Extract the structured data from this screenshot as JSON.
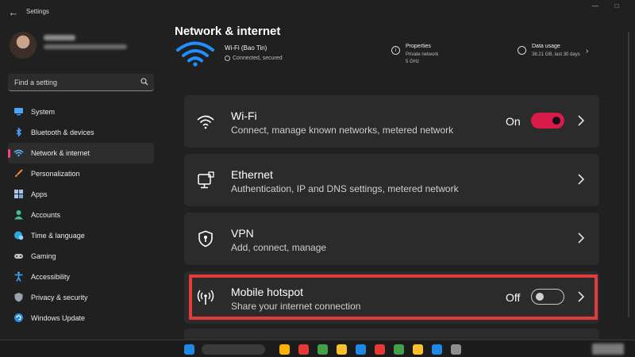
{
  "window": {
    "title": "Settings",
    "back_icon": "back-arrow-icon",
    "controls": [
      "minimize",
      "maximize",
      "close"
    ]
  },
  "user": {
    "name": "Blurred name",
    "email": "Blurred email"
  },
  "search": {
    "placeholder": "Find a setting",
    "icon": "search-icon"
  },
  "sidebar": {
    "items": [
      {
        "label": "System",
        "icon": "monitor-icon",
        "color": "#4aa3ff",
        "selected": false
      },
      {
        "label": "Bluetooth & devices",
        "icon": "bluetooth-icon",
        "color": "#4aa3ff",
        "selected": false
      },
      {
        "label": "Network & internet",
        "icon": "network-icon",
        "color": "#59b8ff",
        "selected": true
      },
      {
        "label": "Personalization",
        "icon": "paintbrush-icon",
        "color": "#f08a3c",
        "selected": false
      },
      {
        "label": "Apps",
        "icon": "apps-icon",
        "color": "#a9c6e8",
        "selected": false
      },
      {
        "label": "Accounts",
        "icon": "person-icon",
        "color": "#3fc08e",
        "selected": false
      },
      {
        "label": "Time & language",
        "icon": "globe-clock-icon",
        "color": "#2fa8e0",
        "selected": false
      },
      {
        "label": "Gaming",
        "icon": "controller-icon",
        "color": "#c0c0c0",
        "selected": false
      },
      {
        "label": "Accessibility",
        "icon": "accessibility-icon",
        "color": "#3ea6ff",
        "selected": false
      },
      {
        "label": "Privacy & security",
        "icon": "shield-icon",
        "color": "#9aa3ad",
        "selected": false
      },
      {
        "label": "Windows Update",
        "icon": "update-icon",
        "color": "#2f8de0",
        "selected": false
      }
    ]
  },
  "header": {
    "title": "Network & internet",
    "network_name": "Wi-Fi (Bao Tin)",
    "network_status": "Connected, secured",
    "properties": {
      "title": "Properties",
      "line1": "Private network",
      "line2": "5 GHz"
    },
    "data_usage": {
      "title": "Data usage",
      "line1": "38.21 GB, last 30 days"
    }
  },
  "cards": [
    {
      "title": "Wi-Fi",
      "description": "Connect, manage known networks, metered network",
      "icon": "wifi-icon",
      "toggle": {
        "label": "On",
        "state": "on"
      }
    },
    {
      "title": "Ethernet",
      "description": "Authentication, IP and DNS settings, metered network",
      "icon": "ethernet-icon"
    },
    {
      "title": "VPN",
      "description": "Add, connect, manage",
      "icon": "vpn-shield-icon"
    },
    {
      "title": "Mobile hotspot",
      "description": "Share your internet connection",
      "icon": "hotspot-icon",
      "toggle": {
        "label": "Off",
        "state": "off"
      },
      "highlighted": true
    }
  ],
  "colors": {
    "background": "#202020",
    "card": "#2b2b2b",
    "accent": "#d81b4a",
    "highlight_border": "#e23b3b",
    "wifi_blue": "#1e90ff"
  }
}
